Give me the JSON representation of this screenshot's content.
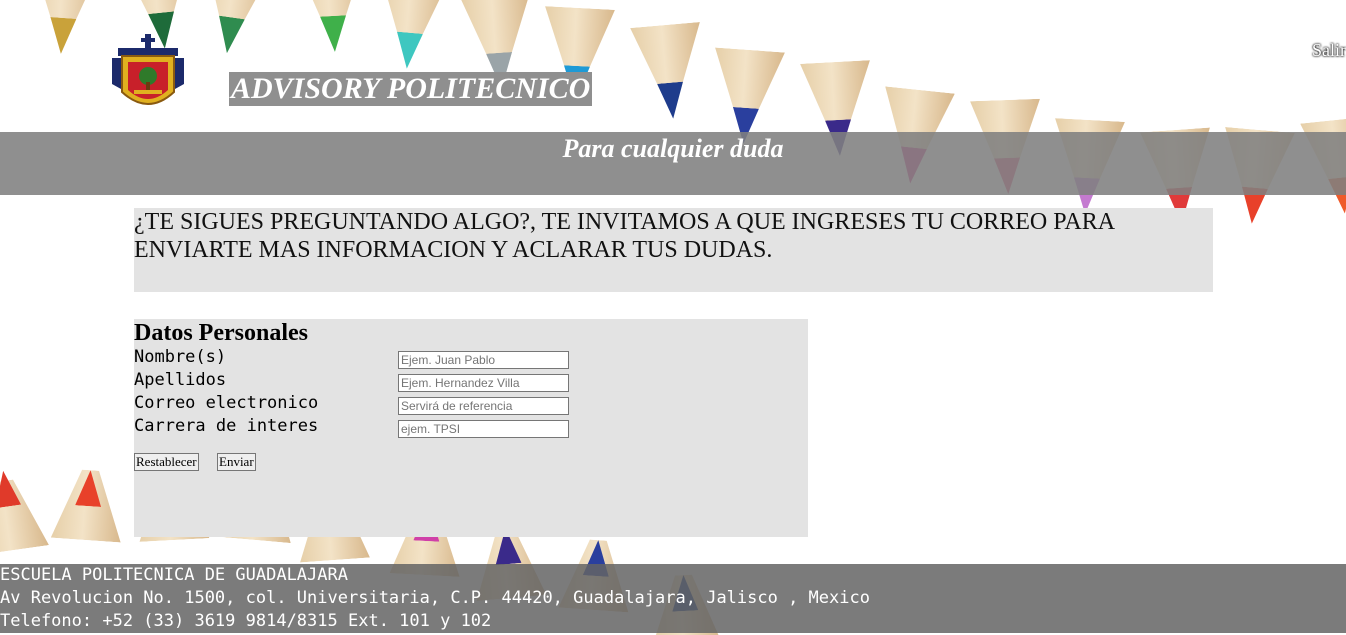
{
  "header": {
    "site_title": "ADVISORY POLITECNICO",
    "logout_label": "Salir",
    "banner_text": "Para cualquier duda"
  },
  "info": {
    "message": "¿TE SIGUES PREGUNTANDO ALGO?, TE INVITAMOS A QUE INGRESES TU CORREO PARA ENVIARTE MAS INFORMACION Y ACLARAR TUS DUDAS."
  },
  "form": {
    "title": "Datos Personales",
    "fields": [
      {
        "label": "Nombre(s)",
        "placeholder": "Ejem. Juan Pablo",
        "value": ""
      },
      {
        "label": "Apellidos",
        "placeholder": "Ejem. Hernandez Villa",
        "value": ""
      },
      {
        "label": "Correo electronico",
        "placeholder": "Servirá de referencia",
        "value": ""
      },
      {
        "label": "Carrera de interes",
        "placeholder": "ejem. TPSI",
        "value": ""
      }
    ],
    "reset_label": "Restablecer",
    "submit_label": "Enviar"
  },
  "footer": {
    "line1": "ESCUELA POLITECNICA DE GUADALAJARA",
    "line2": "Av Revolucion No. 1500, col. Universitaria, C.P. 44420, Guadalajara, Jalisco , Mexico",
    "line3": "Telefono: +52 (33) 3619 9814/8315 Ext. 101 y 102"
  },
  "colors": {
    "banner_bg": "#8f8f8f",
    "panel_bg": "#e3e3e3",
    "footer_bg": "#646464",
    "logo_red": "#c8202a",
    "logo_gold": "#e0b020",
    "logo_navy": "#1c2a6b"
  },
  "icons": {
    "logo": "university-crest-icon"
  }
}
